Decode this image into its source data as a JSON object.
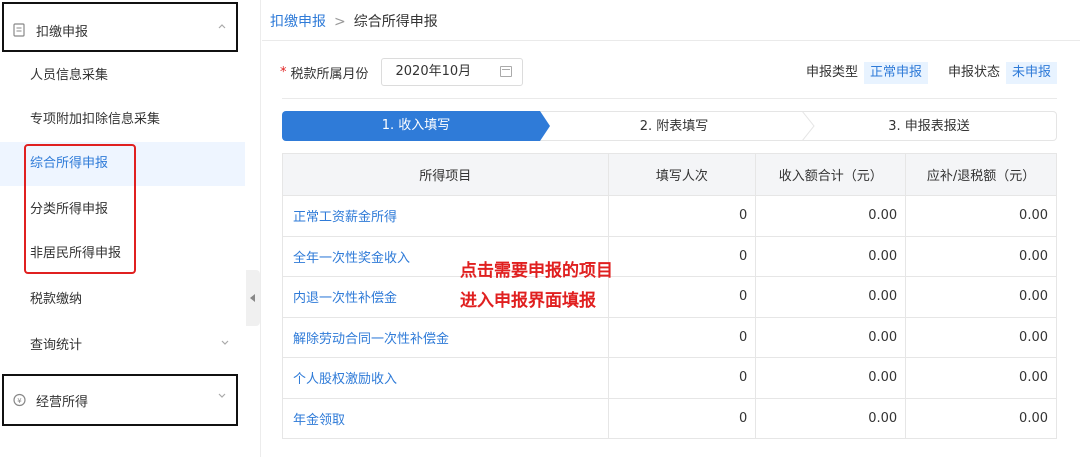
{
  "sidebar": {
    "group_top": {
      "label": "扣缴申报",
      "icon": "document-icon"
    },
    "items": [
      {
        "label": "人员信息采集"
      },
      {
        "label": "专项附加扣除信息采集"
      },
      {
        "label": "综合所得申报"
      },
      {
        "label": "分类所得申报"
      },
      {
        "label": "非居民所得申报"
      },
      {
        "label": "税款缴纳"
      },
      {
        "label": "查询统计"
      }
    ],
    "group_bottom": {
      "label": "经营所得",
      "icon": "shield-icon"
    }
  },
  "breadcrumb": {
    "root": "扣缴申报",
    "separator": ">",
    "current": "综合所得申报"
  },
  "form": {
    "month_label": "税款所属月份",
    "month_value": "2020年10月",
    "type_label": "申报类型",
    "type_value": "正常申报",
    "status_label": "申报状态",
    "status_value": "未申报"
  },
  "steps": [
    "1. 收入填写",
    "2. 附表填写",
    "3. 申报表报送"
  ],
  "table": {
    "headers": [
      "所得项目",
      "填写人次",
      "收入额合计（元）",
      "应补/退税额（元）"
    ],
    "rows": [
      {
        "name": "正常工资薪金所得",
        "count": "0",
        "income": "0.00",
        "tax": "0.00"
      },
      {
        "name": "全年一次性奖金收入",
        "count": "0",
        "income": "0.00",
        "tax": "0.00"
      },
      {
        "name": "内退一次性补偿金",
        "count": "0",
        "income": "0.00",
        "tax": "0.00"
      },
      {
        "name": "解除劳动合同一次性补偿金",
        "count": "0",
        "income": "0.00",
        "tax": "0.00"
      },
      {
        "name": "个人股权激励收入",
        "count": "0",
        "income": "0.00",
        "tax": "0.00"
      },
      {
        "name": "年金领取",
        "count": "0",
        "income": "0.00",
        "tax": "0.00"
      }
    ]
  },
  "annotation": {
    "line1": "点击需要申报的项目",
    "line2": "进入申报界面填报"
  },
  "colors": {
    "accent": "#2f7bd8",
    "annotation": "#e02020",
    "highlight_box": "#e02020",
    "group_box": "#111111"
  }
}
